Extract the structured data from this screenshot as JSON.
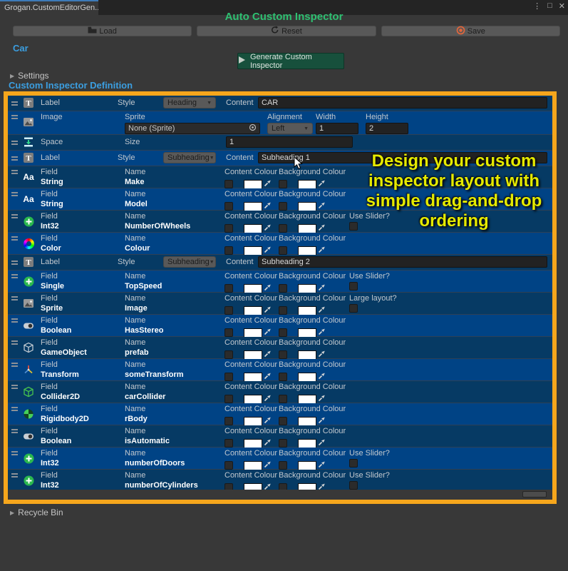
{
  "window": {
    "tab_title": "Grogan.CustomEditorGen..."
  },
  "title": "Auto Custom Inspector",
  "toolbar": {
    "load_label": "Load",
    "reset_label": "Reset",
    "save_label": "Save"
  },
  "object_name": "Car",
  "generate_label": "Generate Custom Inspector",
  "settings_label": "Settings",
  "definition_label": "Custom Inspector Definition",
  "recycle_label": "Recycle Bin",
  "annotation": "Design your custom inspector layout with simple drag-and-drop ordering",
  "column_labels": {
    "label": "Label",
    "style": "Style",
    "content": "Content",
    "field": "Field",
    "name": "Name",
    "content_colour": "Content Colour",
    "background_colour": "Background Colour",
    "image": "Image",
    "sprite": "Sprite",
    "alignment": "Alignment",
    "width": "Width",
    "height": "Height",
    "space": "Space",
    "size": "Size"
  },
  "rows": [
    {
      "kind": "label",
      "icon": "text",
      "style": "Heading",
      "content": "CAR"
    },
    {
      "kind": "image",
      "icon": "image",
      "sprite": "None (Sprite)",
      "alignment": "Left",
      "width": "1",
      "height": "2"
    },
    {
      "kind": "space",
      "icon": "space",
      "size": "1"
    },
    {
      "kind": "label",
      "icon": "text",
      "style": "Subheading",
      "content": "Subheading 1"
    },
    {
      "kind": "field",
      "icon": "string",
      "type": "String",
      "name": "Make"
    },
    {
      "kind": "field",
      "icon": "string",
      "type": "String",
      "name": "Model"
    },
    {
      "kind": "field",
      "icon": "int",
      "type": "Int32",
      "name": "NumberOfWheels",
      "extra": "Use Slider?"
    },
    {
      "kind": "field",
      "icon": "color",
      "type": "Color",
      "name": "Colour"
    },
    {
      "kind": "label",
      "icon": "text",
      "style": "Subheading",
      "content": "Subheading 2"
    },
    {
      "kind": "field",
      "icon": "int",
      "type": "Single",
      "name": "TopSpeed",
      "extra": "Use Slider?"
    },
    {
      "kind": "field",
      "icon": "sprite",
      "type": "Sprite",
      "name": "Image",
      "extra": "Large layout?"
    },
    {
      "kind": "field",
      "icon": "boolean",
      "type": "Boolean",
      "name": "HasStereo"
    },
    {
      "kind": "field",
      "icon": "gameobject",
      "type": "GameObject",
      "name": "prefab"
    },
    {
      "kind": "field",
      "icon": "transform",
      "type": "Transform",
      "name": "someTransform"
    },
    {
      "kind": "field",
      "icon": "collider",
      "type": "Collider2D",
      "name": "carCollider"
    },
    {
      "kind": "field",
      "icon": "rigidbody",
      "type": "Rigidbody2D",
      "name": "rBody"
    },
    {
      "kind": "field",
      "icon": "boolean",
      "type": "Boolean",
      "name": "isAutomatic"
    },
    {
      "kind": "field",
      "icon": "int",
      "type": "Int32",
      "name": "numberOfDoors",
      "extra": "Use Slider?"
    },
    {
      "kind": "field",
      "icon": "int",
      "type": "Int32",
      "name": "numberOfCylinders",
      "extra": "Use Slider?"
    }
  ],
  "colors": {
    "accent_green": "#2ec071",
    "header_blue": "#3b9ee0",
    "row_dark": "#063a64",
    "row_light": "#004385",
    "frame_orange": "#f6a61c",
    "annotation_yellow": "#e5ea00",
    "generate_green": "#17503c"
  }
}
